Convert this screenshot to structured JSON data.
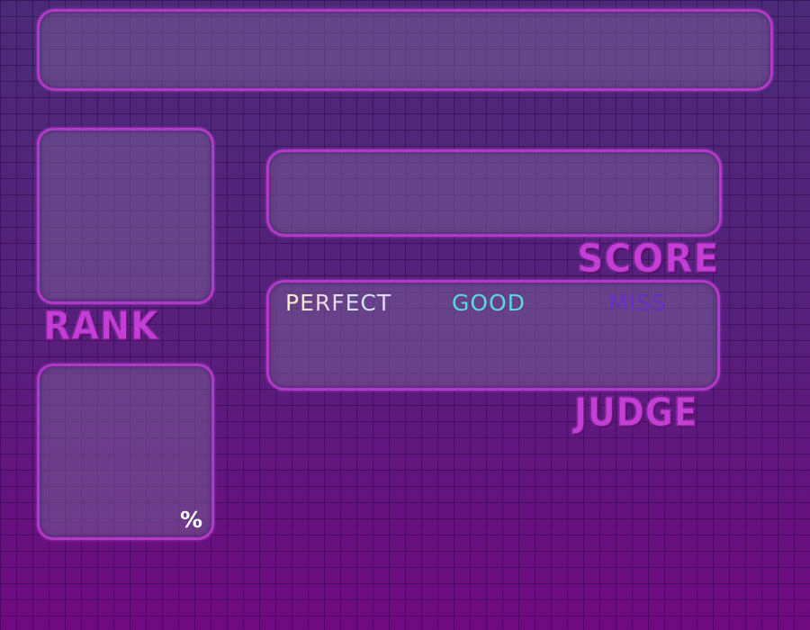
{
  "labels": {
    "score": "SCORE",
    "rank": "RANK",
    "judge": "JUDGE",
    "percent": "%"
  },
  "judge": {
    "perfect": "PERFECT",
    "good": "GOOD",
    "miss": "MISS"
  },
  "colors": {
    "background": "#5a1f7d",
    "panel_border": "#b238c8",
    "label": "#c23ed4",
    "good": "#5bd8e0",
    "miss": "#6a2dc8"
  }
}
